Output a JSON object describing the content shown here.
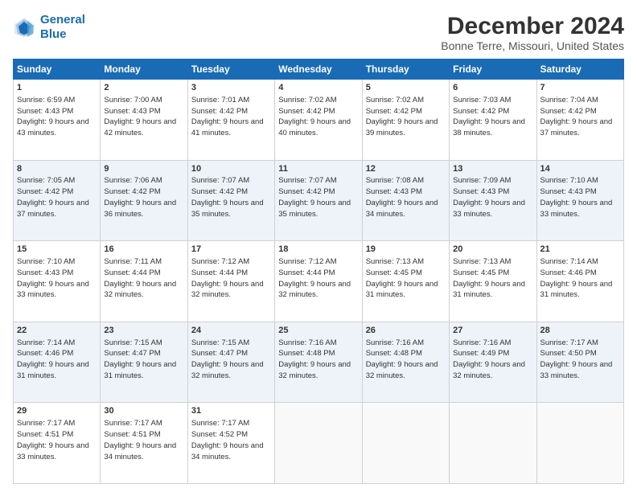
{
  "logo": {
    "line1": "General",
    "line2": "Blue"
  },
  "title": "December 2024",
  "subtitle": "Bonne Terre, Missouri, United States",
  "weekdays": [
    "Sunday",
    "Monday",
    "Tuesday",
    "Wednesday",
    "Thursday",
    "Friday",
    "Saturday"
  ],
  "weeks": [
    [
      {
        "day": "1",
        "sunrise": "6:59 AM",
        "sunset": "4:43 PM",
        "daylight": "9 hours and 43 minutes."
      },
      {
        "day": "2",
        "sunrise": "7:00 AM",
        "sunset": "4:43 PM",
        "daylight": "9 hours and 42 minutes."
      },
      {
        "day": "3",
        "sunrise": "7:01 AM",
        "sunset": "4:42 PM",
        "daylight": "9 hours and 41 minutes."
      },
      {
        "day": "4",
        "sunrise": "7:02 AM",
        "sunset": "4:42 PM",
        "daylight": "9 hours and 40 minutes."
      },
      {
        "day": "5",
        "sunrise": "7:02 AM",
        "sunset": "4:42 PM",
        "daylight": "9 hours and 39 minutes."
      },
      {
        "day": "6",
        "sunrise": "7:03 AM",
        "sunset": "4:42 PM",
        "daylight": "9 hours and 38 minutes."
      },
      {
        "day": "7",
        "sunrise": "7:04 AM",
        "sunset": "4:42 PM",
        "daylight": "9 hours and 37 minutes."
      }
    ],
    [
      {
        "day": "8",
        "sunrise": "7:05 AM",
        "sunset": "4:42 PM",
        "daylight": "9 hours and 37 minutes."
      },
      {
        "day": "9",
        "sunrise": "7:06 AM",
        "sunset": "4:42 PM",
        "daylight": "9 hours and 36 minutes."
      },
      {
        "day": "10",
        "sunrise": "7:07 AM",
        "sunset": "4:42 PM",
        "daylight": "9 hours and 35 minutes."
      },
      {
        "day": "11",
        "sunrise": "7:07 AM",
        "sunset": "4:42 PM",
        "daylight": "9 hours and 35 minutes."
      },
      {
        "day": "12",
        "sunrise": "7:08 AM",
        "sunset": "4:43 PM",
        "daylight": "9 hours and 34 minutes."
      },
      {
        "day": "13",
        "sunrise": "7:09 AM",
        "sunset": "4:43 PM",
        "daylight": "9 hours and 33 minutes."
      },
      {
        "day": "14",
        "sunrise": "7:10 AM",
        "sunset": "4:43 PM",
        "daylight": "9 hours and 33 minutes."
      }
    ],
    [
      {
        "day": "15",
        "sunrise": "7:10 AM",
        "sunset": "4:43 PM",
        "daylight": "9 hours and 33 minutes."
      },
      {
        "day": "16",
        "sunrise": "7:11 AM",
        "sunset": "4:44 PM",
        "daylight": "9 hours and 32 minutes."
      },
      {
        "day": "17",
        "sunrise": "7:12 AM",
        "sunset": "4:44 PM",
        "daylight": "9 hours and 32 minutes."
      },
      {
        "day": "18",
        "sunrise": "7:12 AM",
        "sunset": "4:44 PM",
        "daylight": "9 hours and 32 minutes."
      },
      {
        "day": "19",
        "sunrise": "7:13 AM",
        "sunset": "4:45 PM",
        "daylight": "9 hours and 31 minutes."
      },
      {
        "day": "20",
        "sunrise": "7:13 AM",
        "sunset": "4:45 PM",
        "daylight": "9 hours and 31 minutes."
      },
      {
        "day": "21",
        "sunrise": "7:14 AM",
        "sunset": "4:46 PM",
        "daylight": "9 hours and 31 minutes."
      }
    ],
    [
      {
        "day": "22",
        "sunrise": "7:14 AM",
        "sunset": "4:46 PM",
        "daylight": "9 hours and 31 minutes."
      },
      {
        "day": "23",
        "sunrise": "7:15 AM",
        "sunset": "4:47 PM",
        "daylight": "9 hours and 31 minutes."
      },
      {
        "day": "24",
        "sunrise": "7:15 AM",
        "sunset": "4:47 PM",
        "daylight": "9 hours and 32 minutes."
      },
      {
        "day": "25",
        "sunrise": "7:16 AM",
        "sunset": "4:48 PM",
        "daylight": "9 hours and 32 minutes."
      },
      {
        "day": "26",
        "sunrise": "7:16 AM",
        "sunset": "4:48 PM",
        "daylight": "9 hours and 32 minutes."
      },
      {
        "day": "27",
        "sunrise": "7:16 AM",
        "sunset": "4:49 PM",
        "daylight": "9 hours and 32 minutes."
      },
      {
        "day": "28",
        "sunrise": "7:17 AM",
        "sunset": "4:50 PM",
        "daylight": "9 hours and 33 minutes."
      }
    ],
    [
      {
        "day": "29",
        "sunrise": "7:17 AM",
        "sunset": "4:51 PM",
        "daylight": "9 hours and 33 minutes."
      },
      {
        "day": "30",
        "sunrise": "7:17 AM",
        "sunset": "4:51 PM",
        "daylight": "9 hours and 34 minutes."
      },
      {
        "day": "31",
        "sunrise": "7:17 AM",
        "sunset": "4:52 PM",
        "daylight": "9 hours and 34 minutes."
      },
      null,
      null,
      null,
      null
    ]
  ]
}
